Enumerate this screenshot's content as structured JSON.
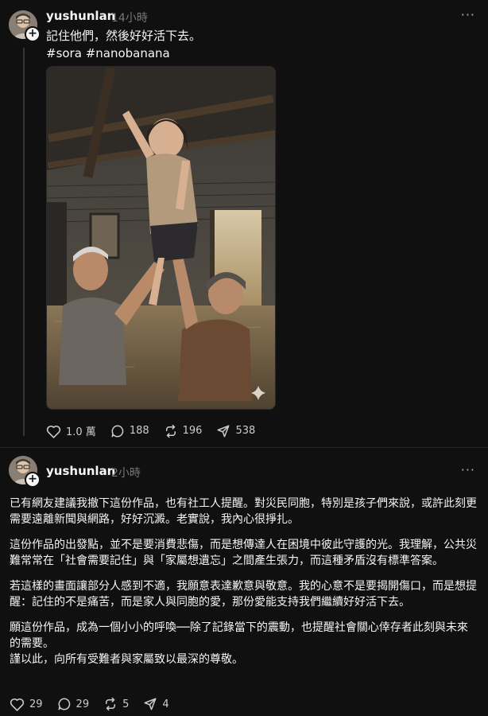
{
  "post1": {
    "username": "yushunlan",
    "time": "14小時",
    "more_label": "···",
    "caption_line1": "記住他們，然後好好活下去。",
    "caption_tags": "#sora #nanobanana",
    "image_alt": "洪水中爺爺奶奶托舉女孩的圖像",
    "stats": {
      "likes": "1.0 萬",
      "comments": "188",
      "reposts": "196",
      "shares": "538"
    }
  },
  "post2": {
    "username": "yushunlan",
    "time": "2小時",
    "more_label": "···",
    "paragraphs": [
      "已有網友建議我撤下這份作品，也有社工人提醒。對災民同胞，特別是孩子們來說，或許此刻更需要遠離新聞與網路，好好沉澱。老實說，我內心很掙扎。",
      "這份作品的出發點，並不是要消費悲傷，而是想傳達人在困境中彼此守護的光。我理解，公共災難常常在「社會需要記住」與「家屬想遺忘」之間產生張力，而這種矛盾沒有標準答案。",
      "若這樣的畫面讓部分人感到不適，我願意表達歉意與敬意。我的心意不是要揭開傷口，而是想提醒：記住的不是痛苦，而是家人與同胞的愛，那份愛能支持我們繼續好好活下去。",
      "願這份作品，成為一個小小的呼喚──除了記錄當下的震動，也提醒社會關心倖存者此刻與未來的需要。"
    ],
    "closing": "謹以此，向所有受難者與家屬致以最深的尊敬。",
    "stats": {
      "likes": "29",
      "comments": "29",
      "reposts": "5",
      "shares": "4"
    }
  },
  "icons": {
    "like": "heart-icon",
    "comment": "comment-bubble-icon",
    "repost": "repost-arrows-icon",
    "share": "send-plane-icon",
    "follow": "plus-icon",
    "sparkle": "sparkle-icon"
  },
  "colors": {
    "background": "#101010",
    "text": "#f3f5f7",
    "muted": "#777777",
    "divider": "#262626"
  }
}
